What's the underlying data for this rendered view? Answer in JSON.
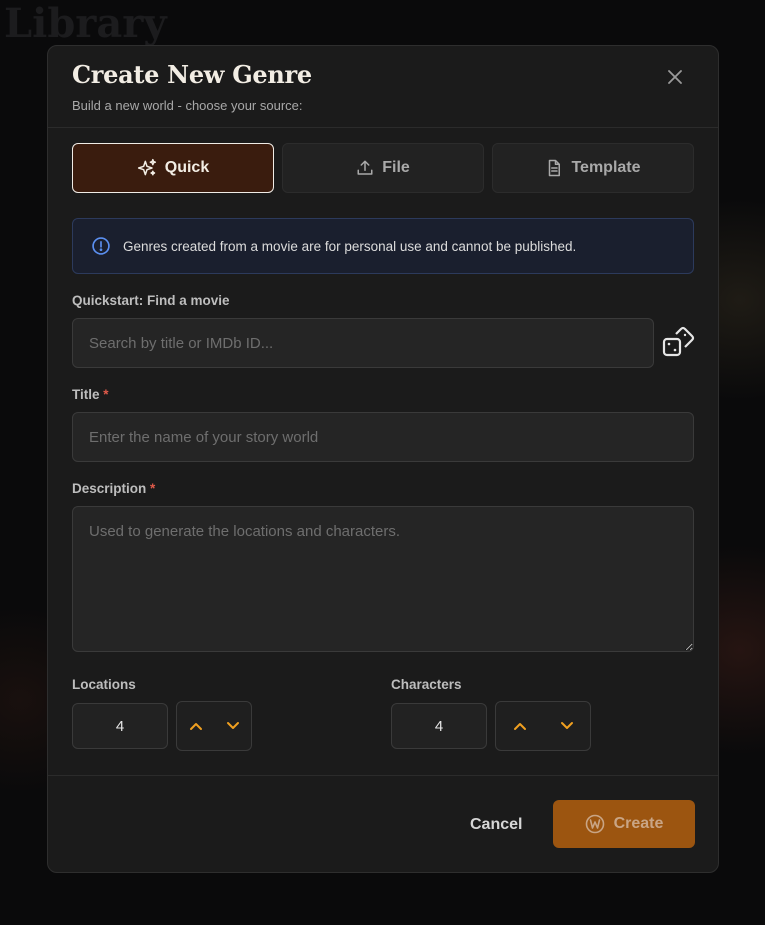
{
  "background": {
    "title": "Library"
  },
  "modal": {
    "title": "Create New Genre",
    "subtitle": "Build a new world - choose your source:"
  },
  "tabs": [
    {
      "label": "Quick",
      "icon": "sparkles-icon",
      "active": true
    },
    {
      "label": "File",
      "icon": "upload-icon",
      "active": false
    },
    {
      "label": "Template",
      "icon": "document-icon",
      "active": false
    }
  ],
  "info": {
    "text": "Genres created from a movie are for personal use and cannot be published.",
    "icon": "info-icon"
  },
  "quickstart": {
    "label": "Quickstart: Find a movie",
    "placeholder": "Search by title or IMDb ID...",
    "value": "",
    "random_icon": "dice-icon"
  },
  "title_field": {
    "label": "Title",
    "required_mark": "*",
    "placeholder": "Enter the name of your story world",
    "value": ""
  },
  "description_field": {
    "label": "Description",
    "required_mark": "*",
    "placeholder": "Used to generate the locations and characters.",
    "value": ""
  },
  "locations": {
    "label": "Locations",
    "value": "4"
  },
  "characters": {
    "label": "Characters",
    "value": "4"
  },
  "footer": {
    "cancel_label": "Cancel",
    "create_label": "Create"
  },
  "colors": {
    "accent": "#f0a020",
    "active_tab_bg": "#3a1c0e",
    "create_bg": "#9c5510",
    "info_bg": "#1a1f2e",
    "info_border": "#2c3a5c",
    "required": "#e05a4a"
  }
}
